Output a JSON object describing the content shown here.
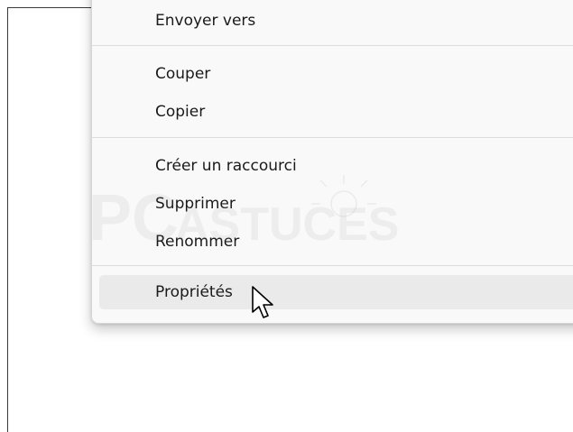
{
  "menu": {
    "items": [
      {
        "label": "Envoyer vers"
      },
      {
        "label": "Couper"
      },
      {
        "label": "Copier"
      },
      {
        "label": "Créer un raccourci"
      },
      {
        "label": "Supprimer"
      },
      {
        "label": "Renommer"
      },
      {
        "label": "Propriétés",
        "hovered": true
      }
    ]
  },
  "watermark": {
    "text_1": "PC",
    "text_2": "ASTUCES"
  },
  "icons": {
    "cursor": "arrow-pointer-icon"
  },
  "colors": {
    "menu_bg": "#f9f9f9",
    "hover_bg": "#eaeaea",
    "separator": "#dcdcdc"
  }
}
